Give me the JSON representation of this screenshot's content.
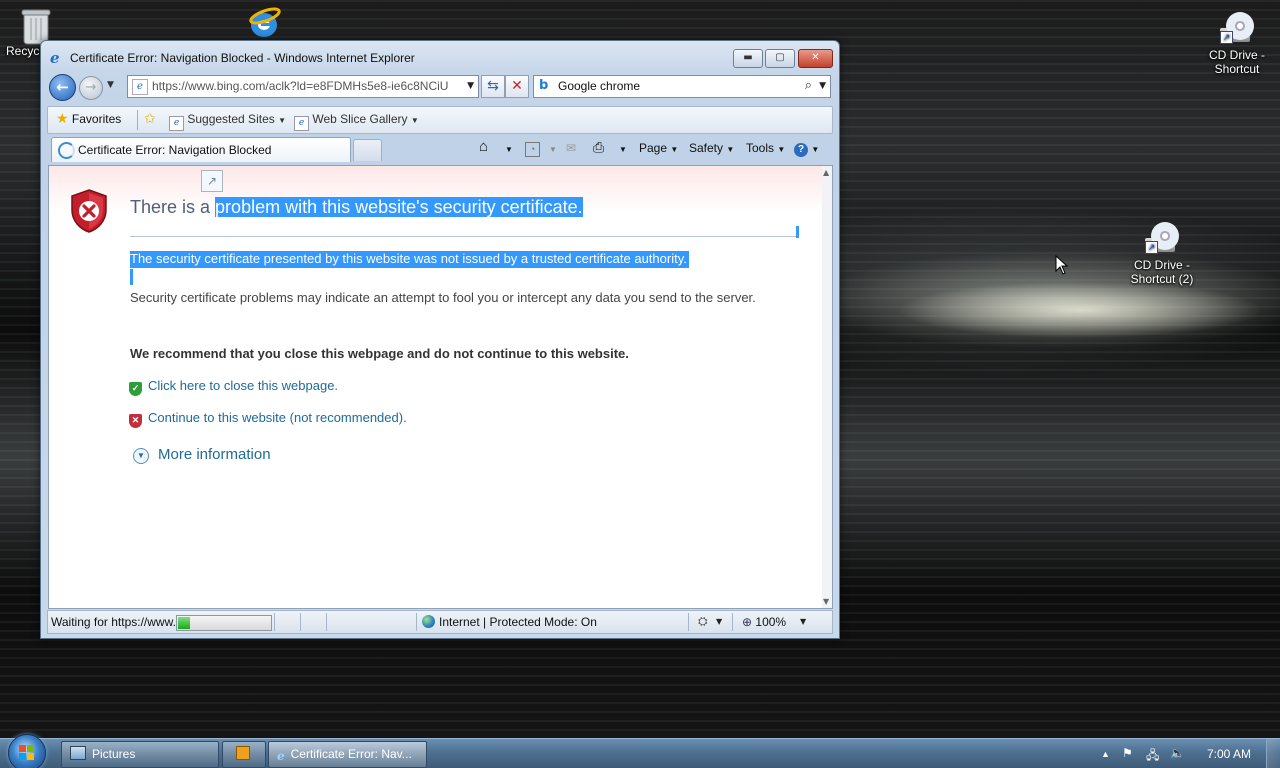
{
  "desktop": {
    "icons": [
      {
        "label": "Recyc",
        "icon": "recycle-bin-icon"
      },
      {
        "label": "",
        "icon": "internet-explorer-icon"
      },
      {
        "label": "CD Drive - Shortcut",
        "icon": "cd-drive-icon"
      },
      {
        "label": "CD Drive - Shortcut (2)",
        "icon": "cd-drive-icon"
      }
    ]
  },
  "window": {
    "title": "Certificate Error: Navigation Blocked - Windows Internet Explorer",
    "controls": {
      "minimize": "▬",
      "maximize": "▢",
      "close": "✕"
    }
  },
  "navbar": {
    "url": "https://www.bing.com/aclk?ld=e8FDMHs5e8-ie6c8NCiU",
    "search_value": "Google chrome",
    "back_glyph": "←",
    "forward_glyph": "→",
    "refresh_glyph": "⇆",
    "stop_glyph": "✕"
  },
  "favorites_bar": {
    "favorites_label": "Favorites",
    "suggested_sites_label": "Suggested Sites",
    "web_slice_label": "Web Slice Gallery"
  },
  "tab": {
    "label": "Certificate Error: Navigation Blocked"
  },
  "commandbar": {
    "page_label": "Page",
    "safety_label": "Safety",
    "tools_label": "Tools"
  },
  "page": {
    "headline_plain": "There is a ",
    "headline_selected": "problem with this website's security certificate.",
    "not_trusted": "The security certificate presented by this website was not issued by a trusted certificate authority.",
    "explanation": "Security certificate problems may indicate an attempt to fool you or intercept any data you send to the server.",
    "recommendation": "We recommend that you close this webpage and do not continue to this website.",
    "close_link": "Click here to close this webpage.",
    "continue_link": "Continue to this website (not recommended).",
    "more_info": "More information"
  },
  "statusbar": {
    "status_text": "Waiting for https://www.bing.com/aclk",
    "progress": 0.13,
    "zone_text": "Internet | Protected Mode: On",
    "zoom": "100%"
  },
  "taskbar": {
    "buttons": [
      {
        "label": "Pictures"
      },
      {
        "label": ""
      },
      {
        "label": "Certificate Error: Nav..."
      }
    ],
    "clock": "7:00 AM"
  },
  "colors": {
    "link": "#1f6a97",
    "selection": "#3399ff",
    "headline": "#4c607a"
  }
}
